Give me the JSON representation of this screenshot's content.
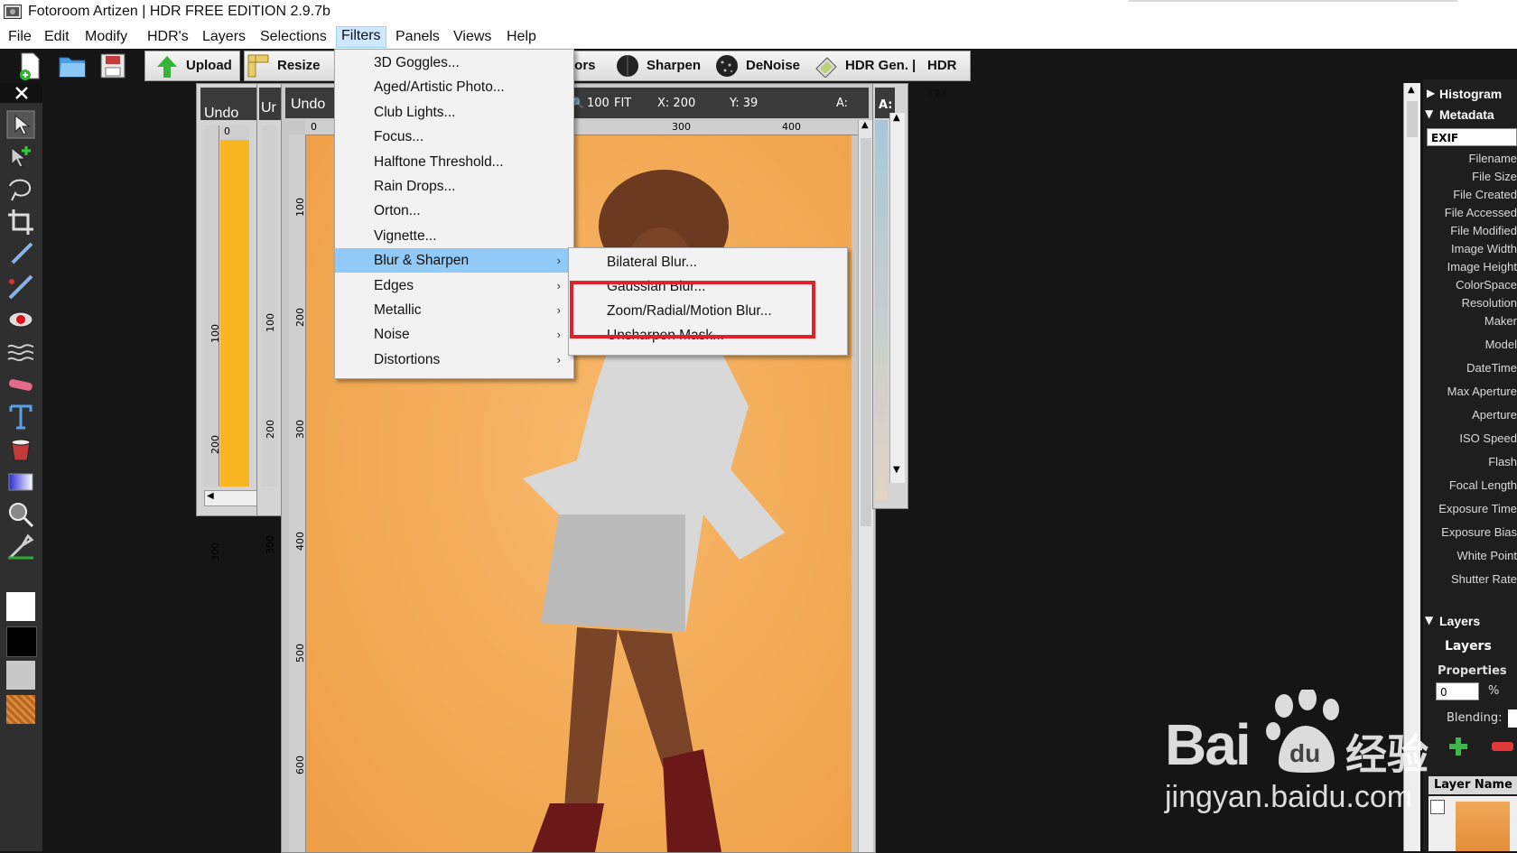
{
  "window": {
    "title": "Fotoroom Artizen | HDR FREE EDITION 2.9.7b"
  },
  "menubar": {
    "items": [
      {
        "label": "File"
      },
      {
        "label": "Edit"
      },
      {
        "label": "Modify"
      },
      {
        "label": "HDR's"
      },
      {
        "label": "Layers"
      },
      {
        "label": "Selections"
      },
      {
        "label": "Filters"
      },
      {
        "label": "Panels"
      },
      {
        "label": "Views"
      },
      {
        "label": "Help"
      }
    ],
    "active": "Filters"
  },
  "toolbar": {
    "upload": "Upload",
    "resize": "Resize",
    "colors_partial": "lors",
    "sharpen": "Sharpen",
    "denoise": "DeNoise",
    "hdr_gen": "HDR Gen.",
    "separator": "|",
    "hdr_tm": "HDR TM"
  },
  "panels": {
    "undo1": "Undo",
    "undo2_partial": "Ur",
    "undo3": "Undo",
    "canvas_zoom": "100",
    "canvas_fit": "FIT",
    "coord_x": "X: 200",
    "coord_y": "Y: 39",
    "coord_a": "A:",
    "side_a": "A:",
    "ruler_h": [
      "0",
      "300",
      "400"
    ],
    "ruler_v_left": [
      "0",
      "100",
      "200",
      "300"
    ],
    "ruler_v_mid": [
      "100",
      "200",
      "300"
    ],
    "ruler_v_main": [
      "100",
      "200",
      "300",
      "400",
      "500",
      "600"
    ]
  },
  "filters_menu": {
    "items": [
      {
        "label": "3D Goggles...",
        "submenu": false
      },
      {
        "label": "Aged/Artistic Photo...",
        "submenu": false
      },
      {
        "label": "Club Lights...",
        "submenu": false
      },
      {
        "label": "Focus...",
        "submenu": false
      },
      {
        "label": "Halftone Threshold...",
        "submenu": false
      },
      {
        "label": "Rain Drops...",
        "submenu": false
      },
      {
        "label": "Orton...",
        "submenu": false
      },
      {
        "label": "Vignette...",
        "submenu": false
      },
      {
        "label": "Blur & Sharpen",
        "submenu": true
      },
      {
        "label": "Edges",
        "submenu": true
      },
      {
        "label": "Metallic",
        "submenu": true
      },
      {
        "label": "Noise",
        "submenu": true
      },
      {
        "label": "Distortions",
        "submenu": true
      }
    ],
    "highlighted": "Blur & Sharpen"
  },
  "blur_submenu": {
    "items": [
      {
        "label": "Bilateral Blur..."
      },
      {
        "label": "Gaussian Blur..."
      },
      {
        "label": "Zoom/Radial/Motion Blur..."
      },
      {
        "label": "Unsharpen Mask..."
      }
    ],
    "boxed": "Zoom/Radial/Motion Blur...",
    "box_color": "#e0202a"
  },
  "right_panel": {
    "histogram": "Histogram",
    "metadata": "Metadata",
    "exif_select": "EXIF",
    "fields": [
      "Filename",
      "File Size",
      "File Created",
      "File Accessed",
      "File Modified",
      "Image Width",
      "Image Height",
      "ColorSpace",
      "Resolution",
      "Maker",
      "Model",
      "DateTime",
      "Max Aperture",
      "Aperture",
      "ISO Speed",
      "Flash",
      "Focal Length",
      "Exposure Time",
      "Exposure Bias",
      "White Point",
      "Shutter Rate"
    ],
    "layers_section": "Layers",
    "layers_title": "Layers",
    "properties": "Properties",
    "opacity_value": "0",
    "percent": "%",
    "blending": "Blending:",
    "layer_name": "Layer Name"
  },
  "watermark": {
    "brand": "Bai",
    "du": "du",
    "cn": "经验",
    "url": "jingyan.baidu.com"
  },
  "colors": {
    "menu_highlight": "#91c9f7",
    "accent_box": "#e0202a",
    "photo_bg": "#f3ad5c"
  }
}
